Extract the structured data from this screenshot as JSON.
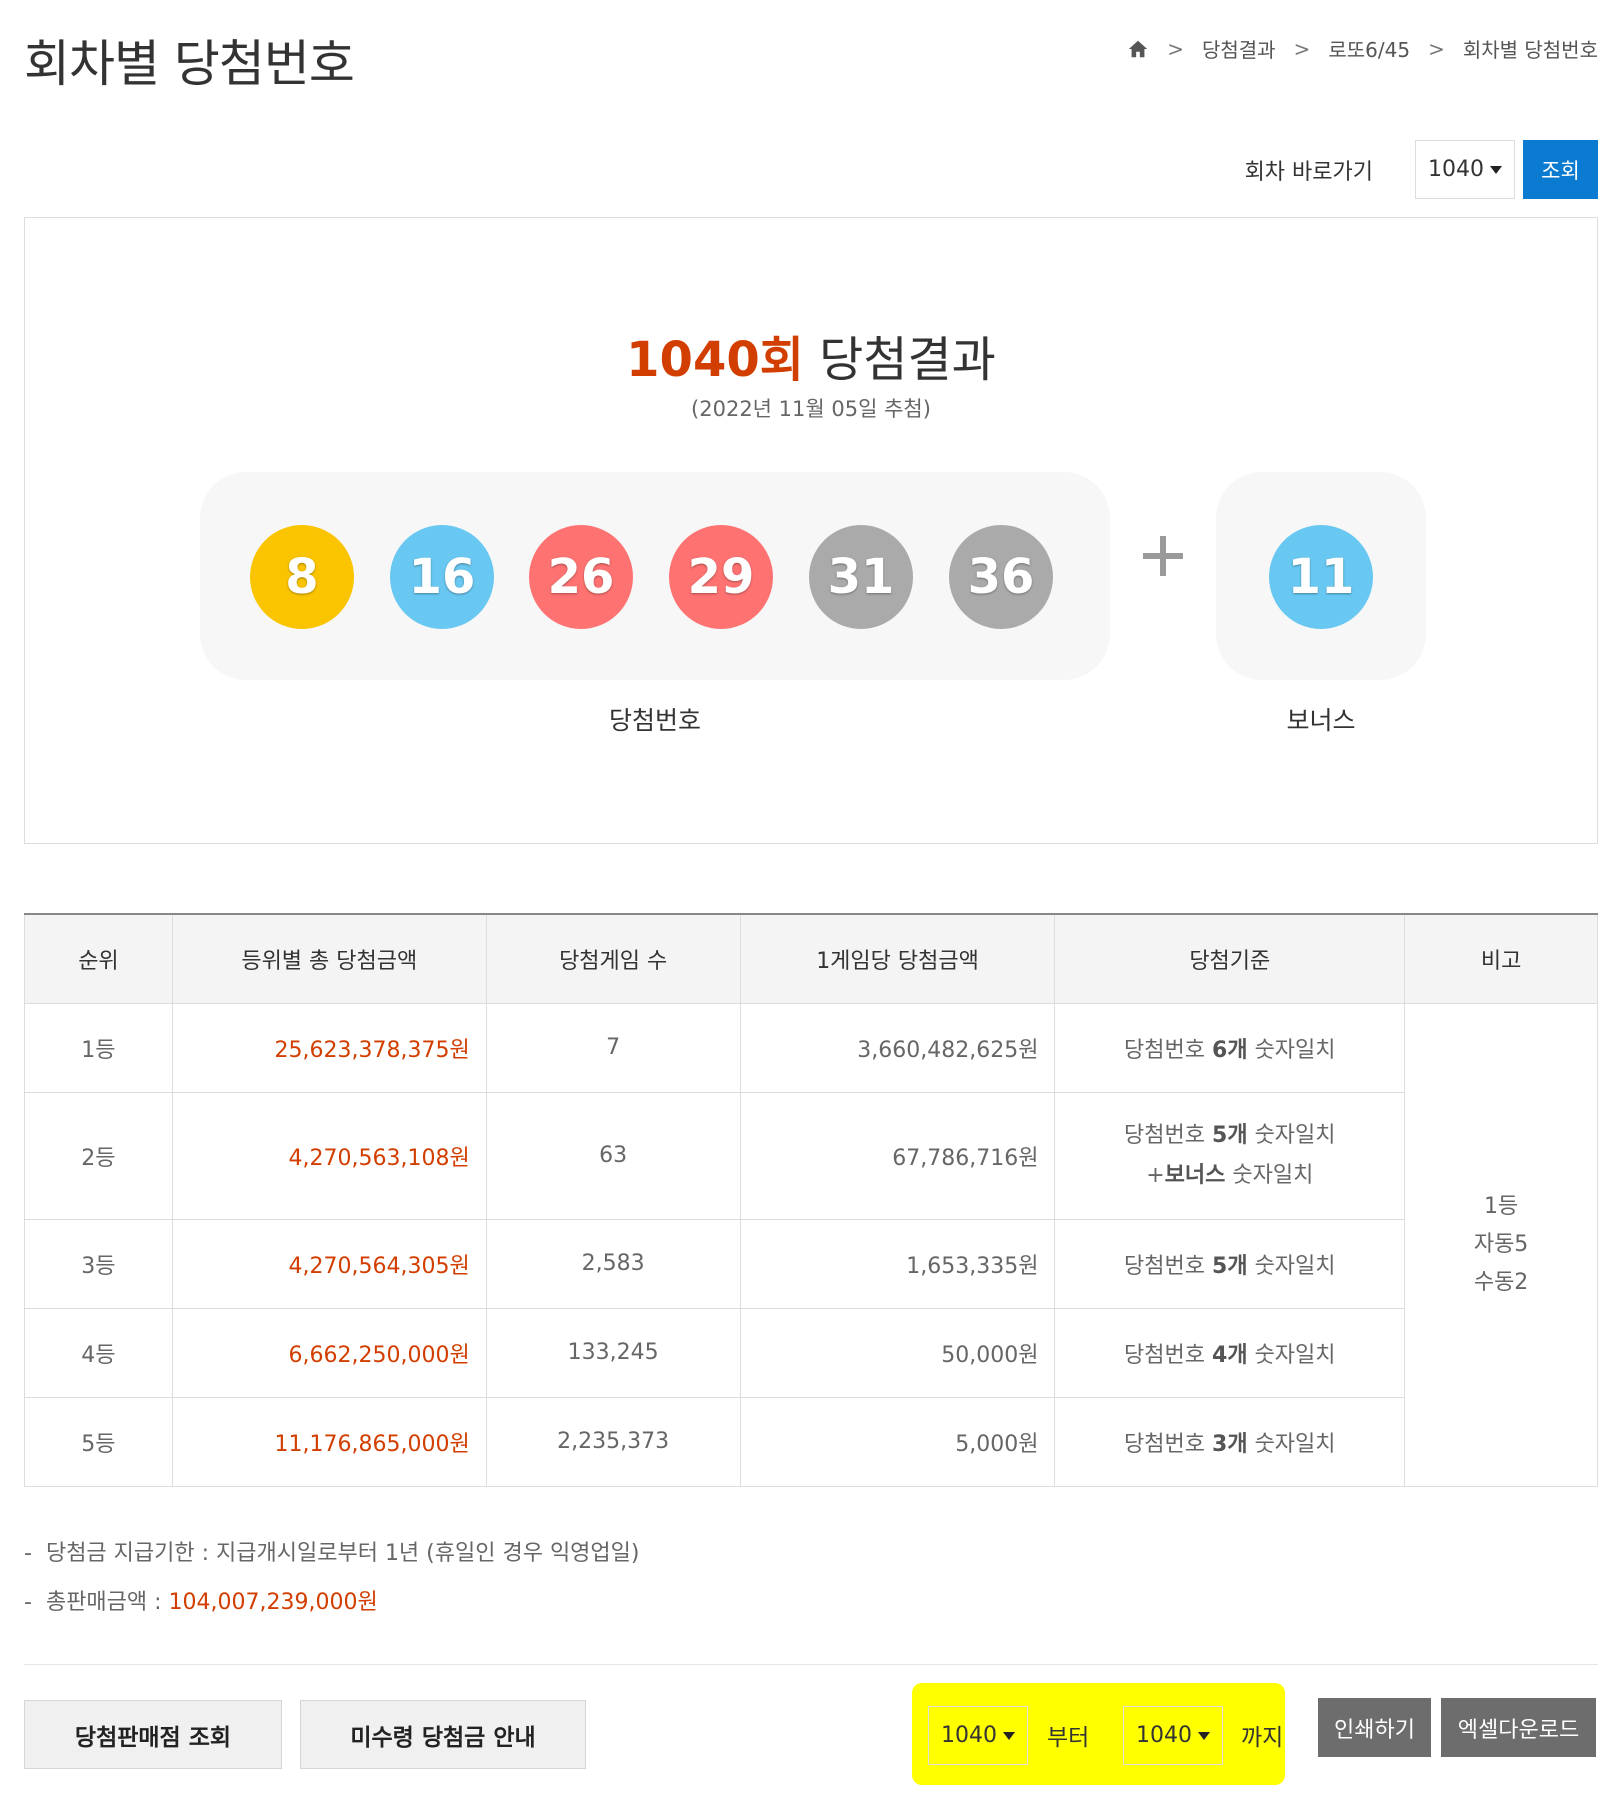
{
  "header": {
    "title": "회차별 당첨번호",
    "breadcrumb": [
      "당첨결과",
      "로또6/45",
      "회차별 당첨번호"
    ]
  },
  "jump": {
    "label": "회차 바로가기",
    "selected": "1040",
    "button": "조회"
  },
  "result": {
    "round": "1040회",
    "title_suffix": " 당첨결과",
    "date": "(2022년 11월 05일 추첨)",
    "numbers": [
      "8",
      "16",
      "26",
      "29",
      "31",
      "36"
    ],
    "bonus": "11",
    "numbers_label": "당첨번호",
    "bonus_label": "보너스",
    "colors": {
      "yellow": "#fbc400",
      "blue": "#69c8f2",
      "red": "#ff7272",
      "gray": "#aaaaaa"
    }
  },
  "table": {
    "headers": [
      "순위",
      "등위별 총 당첨금액",
      "당첨게임 수",
      "1게임당 당첨금액",
      "당첨기준",
      "비고"
    ],
    "rows": [
      {
        "rank": "1등",
        "total": "25,623,378,375원",
        "games": "7",
        "per_game": "3,660,482,625원",
        "crit_pre": "당첨번호 ",
        "crit_bold": "6개",
        "crit_post": " 숫자일치"
      },
      {
        "rank": "2등",
        "total": "4,270,563,108원",
        "games": "63",
        "per_game": "67,786,716원",
        "crit_pre": "당첨번호 ",
        "crit_bold": "5개",
        "crit_post": " 숫자일치",
        "crit2_pre": "+",
        "crit2_bold": "보너스",
        "crit2_post": " 숫자일치"
      },
      {
        "rank": "3등",
        "total": "4,270,564,305원",
        "games": "2,583",
        "per_game": "1,653,335원",
        "crit_pre": "당첨번호 ",
        "crit_bold": "5개",
        "crit_post": " 숫자일치"
      },
      {
        "rank": "4등",
        "total": "6,662,250,000원",
        "games": "133,245",
        "per_game": "50,000원",
        "crit_pre": "당첨번호 ",
        "crit_bold": "4개",
        "crit_post": " 숫자일치"
      },
      {
        "rank": "5등",
        "total": "11,176,865,000원",
        "games": "2,235,373",
        "per_game": "5,000원",
        "crit_pre": "당첨번호 ",
        "crit_bold": "3개",
        "crit_post": " 숫자일치"
      }
    ],
    "note": [
      "1등",
      "자동5",
      "수동2"
    ]
  },
  "info": {
    "deadline": "당첨금 지급기한 : 지급개시일로부터 1년 (휴일인 경우 익영업일)",
    "sales_label": "총판매금액 : ",
    "sales_value": "104,007,239,000원"
  },
  "actions": {
    "store_button": "당첨판매점 조회",
    "unclaimed_button": "미수령 당첨금 안내",
    "from_select": "1040",
    "from_text": "부터",
    "to_select": "1040",
    "to_text": "까지",
    "print_button": "인쇄하기",
    "excel_button": "엑셀다운로드"
  }
}
